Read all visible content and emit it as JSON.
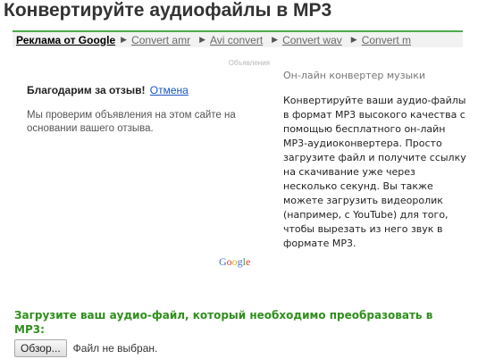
{
  "header": {
    "title": "Конвертируйте аудиофайлы в MP3"
  },
  "adlinks": {
    "label": "Реклама от Google",
    "items": [
      "Convert amr",
      "Avi convert",
      "Convert wav",
      "Convert m"
    ]
  },
  "ad": {
    "marker": "Объявления",
    "thanks": "Благодарим за отзыв!",
    "cancel": "Отмена",
    "note": "Мы проверим объявления на этом сайте на основании вашего отзыва.",
    "logo_text": "Google",
    "logo_colors": [
      "#3b6fd4",
      "#d6412f",
      "#e8b321",
      "#3b6fd4",
      "#3a9b3f",
      "#d6412f"
    ]
  },
  "sidebar": {
    "title": "Он-лайн конвертер музыки",
    "text": "Конвертируйте ваши аудио-файлы в формат MP3 высокого качества с помощью бесплатного он-лайн MP3-аудиоконвертера. Просто загрузите файл и получите ссылку на скачивание уже через несколько секунд. Вы также можете загрузить видеоролик (например, с YouTube) для того, чтобы вырезать из него звук в формате MP3."
  },
  "upload": {
    "heading": "Загрузите ваш аудио-файл, который необходимо преобразовать в MP3:",
    "browse_label": "Обзор...",
    "file_status": "Файл не выбран."
  },
  "colors": {
    "accent_green": "#2f8f1c",
    "bar_border": "#4caa4c",
    "link_blue": "#1a55c4"
  }
}
